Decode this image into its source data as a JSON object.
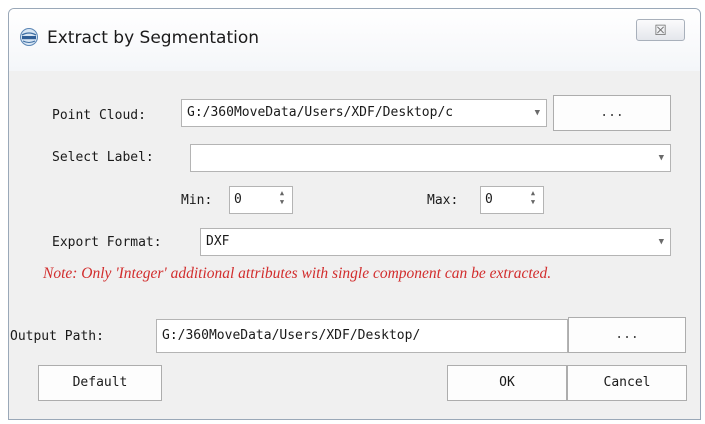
{
  "window": {
    "title": "Extract by Segmentation",
    "close_glyph": "☒",
    "icon": "app-globe-icon"
  },
  "point_cloud": {
    "label": "Point Cloud:",
    "value": "G:/360MoveData/Users/XDF/Desktop/c",
    "browse_label": "..."
  },
  "select_label": {
    "label": "Select Label:",
    "value": ""
  },
  "range": {
    "min_label": "Min:",
    "min_value": "0",
    "max_label": "Max:",
    "max_value": "0"
  },
  "export_format": {
    "label": "Export Format:",
    "value": "DXF"
  },
  "note": "Note: Only 'Integer' additional attributes with single component can be extracted.",
  "output_path": {
    "label": "Output Path:",
    "value": "G:/360MoveData/Users/XDF/Desktop/",
    "browse_label": "..."
  },
  "buttons": {
    "default": "Default",
    "ok": "OK",
    "cancel": "Cancel"
  },
  "colors": {
    "note": "#d22d2d",
    "dialog_bg": "#f0f0f0"
  }
}
